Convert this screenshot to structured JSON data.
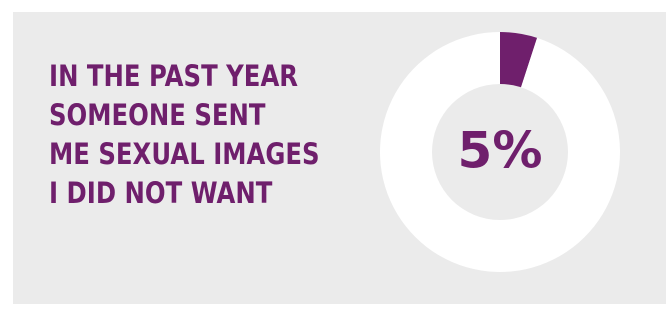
{
  "statement": {
    "lines": [
      "IN THE PAST YEAR",
      "SOMEONE SENT",
      "ME SEXUAL IMAGES",
      "I DID NOT WANT"
    ]
  },
  "chart_data": {
    "type": "pie",
    "variant": "donut",
    "categories": [
      "",
      ""
    ],
    "values": [
      5,
      95
    ],
    "center_label": "5%",
    "colors": {
      "highlight": "#6f1f6c",
      "remainder": "#ffffff",
      "center": "#ebebeb",
      "background": "#ebebeb",
      "text": "#6f1f6c"
    }
  }
}
